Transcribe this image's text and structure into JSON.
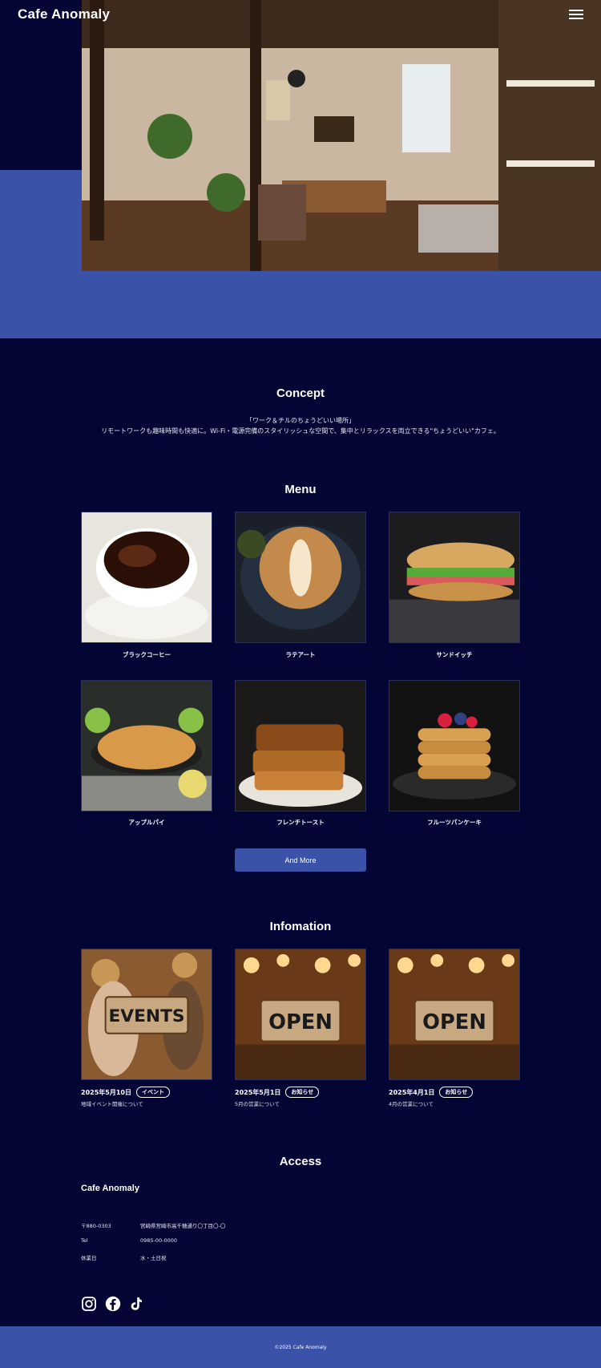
{
  "header": {
    "logo": "Cafe Anomaly",
    "menu_icon": "hamburger-menu-icon"
  },
  "concept": {
    "title": "Concept",
    "line1": "「ワーク＆チルのちょうどいい場所」",
    "line2": "リモートワークも趣味時間も快適に。Wi-Fi・電源完備のスタイリッシュな空間で、集中とリラックスを両立できる\"ちょうどいい\"カフェ。"
  },
  "menu": {
    "title": "Menu",
    "items": [
      {
        "label": "ブラックコーヒー"
      },
      {
        "label": "ラテアート"
      },
      {
        "label": "サンドイッチ"
      },
      {
        "label": "アップルパイ"
      },
      {
        "label": "フレンチトースト"
      },
      {
        "label": "フルーツパンケーキ"
      }
    ],
    "more_label": "And More"
  },
  "info": {
    "title": "Infomation",
    "items": [
      {
        "date": "2025年5月10日",
        "tag": "イベント",
        "desc": "地域イベント開催について",
        "sign": "EVENTS"
      },
      {
        "date": "2025年5月1日",
        "tag": "お知らせ",
        "desc": "5月の営業について",
        "sign": "OPEN"
      },
      {
        "date": "2025年4月1日",
        "tag": "お知らせ",
        "desc": "4月の営業について",
        "sign": "OPEN"
      }
    ]
  },
  "access": {
    "title": "Access",
    "name": "Cafe Anomaly",
    "rows": [
      {
        "key": "〒880-0303",
        "value": "宮崎県宮崎市高千穂通り〇丁目〇-〇"
      },
      {
        "key": "Tel",
        "value": "0985-00-0000"
      },
      {
        "key": "休業日",
        "value": "水・土日祝"
      }
    ]
  },
  "social": [
    "instagram-icon",
    "facebook-icon",
    "tiktok-icon"
  ],
  "footer": {
    "copyright": "©2025 Cafe Anomaly"
  },
  "colors": {
    "background": "#030534",
    "accent": "#3a52a8"
  }
}
